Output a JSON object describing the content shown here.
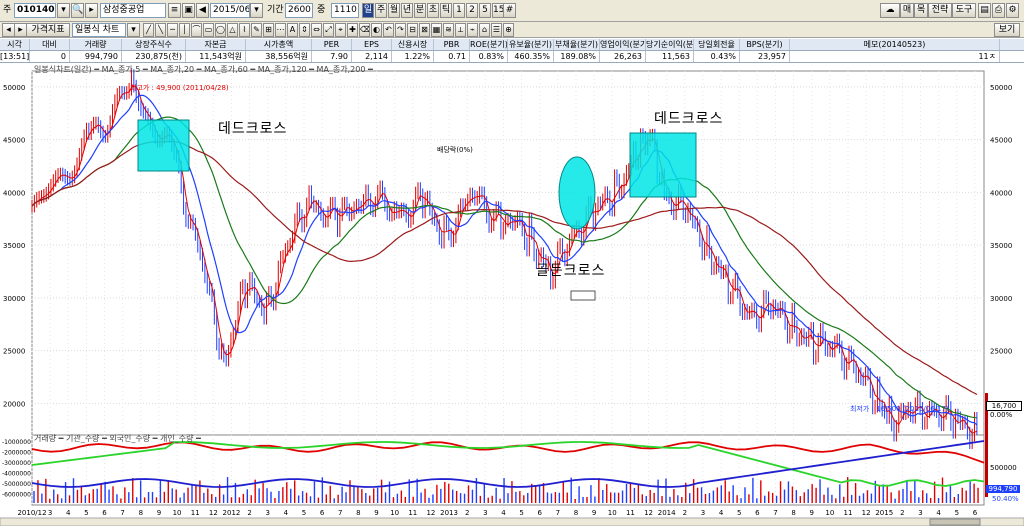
{
  "toolbar": {
    "code_label": "주",
    "code": "010140",
    "name": "삼성중공업",
    "date": "2015/06/17",
    "period_label": "기간",
    "period": "2600",
    "count_label": "중",
    "count": "1110",
    "unit_buttons": [
      "일",
      "주",
      "월",
      "년",
      "분",
      "초",
      "틱",
      "1",
      "2",
      "5",
      "15"
    ],
    "right_buttons": [
      "매",
      "목",
      "전략",
      "도구"
    ]
  },
  "toolbar2": {
    "sise_label": "시각",
    "indicator_label": "가격지표",
    "chart_type": "일봉식 차트",
    "view_button": "보기"
  },
  "info": {
    "headers": [
      "시각",
      "대비",
      "거래량",
      "상장주식수",
      "자본금",
      "시가총액",
      "PER",
      "EPS",
      "신용시장",
      "PBR",
      "ROE(분기)",
      "유보율(분기)",
      "부채율(분기)",
      "영업이익(분기)",
      "당기순이익(분기)",
      "당일회전율",
      "BPS(분기)",
      "메모(20140523)"
    ],
    "values": [
      "[13:51]",
      "0",
      "994,790",
      "230,875(천)",
      "11,543억원",
      "38,556억원",
      "7.90",
      "2,114",
      "1.22%",
      "0.71",
      "0.83%",
      "460.35%",
      "189.08%",
      "26,263",
      "11,563",
      "0.43%",
      "23,957",
      "11ㅈ"
    ]
  },
  "legend": {
    "price": "일봉식차트(일간) ━ MA_종가,5 ━ MA_종가,20 ━ MA_종가,60 ━ MA_종가,120 ━ MA_종가,200 ━",
    "volume": "거래량 ━ 기관_수량 ━ 외국인_수량 ━ 개인_수량 ━"
  },
  "annotations": {
    "high": "최고가 : 49,900 (2011/04/28)",
    "low": "최저가 : 16,500 (2015/06/17)",
    "dead_cross_1": "데드크로스",
    "dead_cross_2": "데드크로스",
    "golden_cross": "골든크로스",
    "dividend": "배당락(0%)",
    "price_tag": "16,700",
    "price_pct": "0.00%",
    "vol_tag": "994,790",
    "vol_pct": "50.40%"
  },
  "colors": {
    "ma5": "#e00000",
    "ma20": "#1f3fff",
    "ma60": "#1a7a1a",
    "ma120": "#9b1b1b",
    "price_up": "#e00000",
    "price_down": "#1f3fff",
    "cross_box": "#00e5e5"
  },
  "chart_data": {
    "type": "line",
    "series_names": [
      "MA_종가,5",
      "MA_종가,20",
      "MA_종가,60",
      "MA_종가,120",
      "MA_종가,200"
    ],
    "y_axis_ticks": [
      50000,
      45000,
      40000,
      35000,
      30000,
      25000,
      20000
    ],
    "x_axis_ticks": [
      "2010/12",
      "3",
      "4",
      "5",
      "6",
      "7",
      "8",
      "9",
      "10",
      "11",
      "12",
      "2012",
      "2",
      "3",
      "4",
      "5",
      "6",
      "7",
      "8",
      "9",
      "10",
      "11",
      "12",
      "2013",
      "2",
      "3",
      "4",
      "5",
      "6",
      "7",
      "8",
      "9",
      "10",
      "11",
      "12",
      "2014",
      "2",
      "3",
      "4",
      "5",
      "6",
      "7",
      "8",
      "9",
      "10",
      "11",
      "12",
      "2015",
      "2",
      "3",
      "4",
      "5",
      "6"
    ],
    "vol_axis_ticks_left": [
      "-1000000",
      "-2000000",
      "-3000000",
      "-4000000",
      "-5000000",
      "-6000000"
    ],
    "vol_axis_ticks_right": [
      "500000"
    ],
    "ylim": [
      17000,
      51500
    ],
    "price_path": [
      [
        0,
        38000
      ],
      [
        8,
        45000
      ],
      [
        14,
        49900
      ],
      [
        20,
        43000
      ],
      [
        24,
        33000
      ],
      [
        27,
        24000
      ],
      [
        30,
        31000
      ],
      [
        33,
        29000
      ],
      [
        36,
        35000
      ],
      [
        39,
        39500
      ],
      [
        43,
        37000
      ],
      [
        47,
        40000
      ],
      [
        51,
        38000
      ],
      [
        55,
        39000
      ],
      [
        58,
        36000
      ],
      [
        62,
        39500
      ],
      [
        66,
        37500
      ],
      [
        70,
        36000
      ],
      [
        73,
        32000
      ],
      [
        76,
        36000
      ],
      [
        79,
        38000
      ],
      [
        82,
        40000
      ],
      [
        85,
        43500
      ],
      [
        87,
        45500
      ],
      [
        89,
        40000
      ],
      [
        92,
        38000
      ],
      [
        95,
        35000
      ],
      [
        98,
        31000
      ],
      [
        101,
        28500
      ],
      [
        104,
        29000
      ],
      [
        107,
        27500
      ],
      [
        110,
        25500
      ],
      [
        113,
        25500
      ],
      [
        116,
        23000
      ],
      [
        119,
        20500
      ],
      [
        121,
        18500
      ],
      [
        124,
        19000
      ],
      [
        127,
        19500
      ],
      [
        130,
        18000
      ],
      [
        133,
        17600
      ]
    ],
    "x_max": 134
  }
}
